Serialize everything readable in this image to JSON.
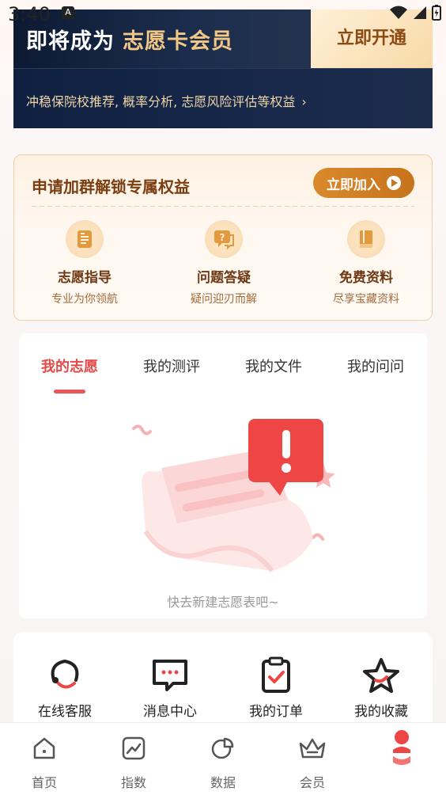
{
  "status_bar": {
    "time": "3:40",
    "badge": "A"
  },
  "vip_banner": {
    "title": "即将成为",
    "title_highlight": "志愿卡会员",
    "open_label": "立即开通",
    "description": "冲稳保院校推荐, 概率分析, 志愿风险评估等权益",
    "chevron": "›"
  },
  "group_card": {
    "title": "申请加群解锁专属权益",
    "join_label": "立即加入",
    "features": [
      {
        "name": "志愿指导",
        "desc": "专业为你领航",
        "icon": "document-icon"
      },
      {
        "name": "问题答疑",
        "desc": "疑问迎刃而解",
        "icon": "question-chat-icon"
      },
      {
        "name": "免费资料",
        "desc": "尽享宝藏资料",
        "icon": "book-icon"
      }
    ]
  },
  "tabs": [
    {
      "label": "我的志愿",
      "active": true
    },
    {
      "label": "我的测评",
      "active": false
    },
    {
      "label": "我的文件",
      "active": false
    },
    {
      "label": "我的问问",
      "active": false
    }
  ],
  "empty_state": {
    "text": "快去新建志愿表吧~",
    "icon": "empty-document-alert-icon"
  },
  "shortcuts": [
    {
      "label": "在线客服",
      "icon": "headset-icon"
    },
    {
      "label": "消息中心",
      "icon": "message-icon"
    },
    {
      "label": "我的订单",
      "icon": "clipboard-check-icon"
    },
    {
      "label": "我的收藏",
      "icon": "star-icon"
    }
  ],
  "bottom_nav": [
    {
      "label": "首页",
      "icon": "home-icon"
    },
    {
      "label": "指数",
      "icon": "trend-chart-icon"
    },
    {
      "label": "数据",
      "icon": "pie-chart-icon"
    },
    {
      "label": "会员",
      "icon": "crown-icon"
    },
    {
      "label": "",
      "icon": "profile-icon"
    }
  ],
  "colors": {
    "accent": "#e54a4a",
    "gold": "#f3c785",
    "navy": "#0f2040",
    "join_button": "#d98a2b"
  }
}
